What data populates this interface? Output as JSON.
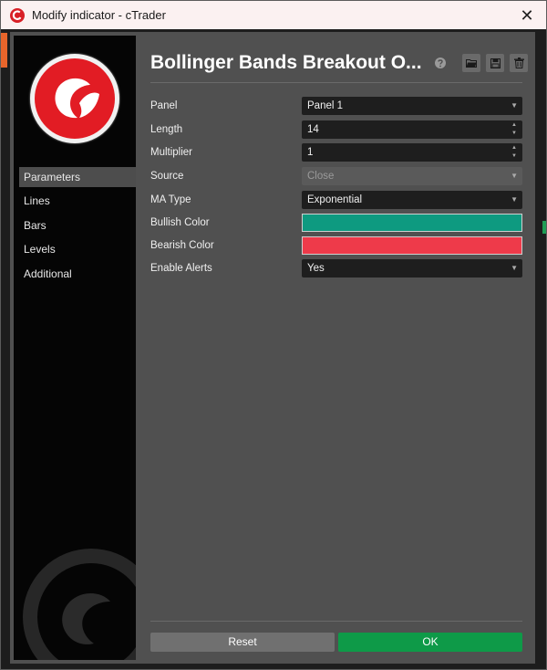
{
  "window": {
    "title": "Modify indicator - cTrader",
    "close_glyph": "✕",
    "app_icon": "ctrader-logo-icon"
  },
  "sidebar": {
    "logo": "ctrader-logo-icon",
    "items": [
      {
        "label": "Parameters",
        "active": true
      },
      {
        "label": "Lines",
        "active": false
      },
      {
        "label": "Bars",
        "active": false
      },
      {
        "label": "Levels",
        "active": false
      },
      {
        "label": "Additional",
        "active": false
      }
    ]
  },
  "header": {
    "title": "Bollinger Bands Breakout O...",
    "icons": [
      "help-icon",
      "open-folder-icon",
      "save-icon",
      "trash-icon"
    ]
  },
  "parameters": {
    "panel": {
      "label": "Panel",
      "value": "Panel 1"
    },
    "length": {
      "label": "Length",
      "value": "14"
    },
    "multiplier": {
      "label": "Multiplier",
      "value": "1"
    },
    "source": {
      "label": "Source",
      "value": "Close"
    },
    "ma_type": {
      "label": "MA Type",
      "value": "Exponential"
    },
    "bullish_color": {
      "label": "Bullish Color",
      "color": "#0e9a80"
    },
    "bearish_color": {
      "label": "Bearish Color",
      "color": "#ee3a4a"
    },
    "enable_alerts": {
      "label": "Enable Alerts",
      "value": "Yes"
    }
  },
  "footer": {
    "reset_label": "Reset",
    "ok_label": "OK"
  },
  "colors": {
    "brand_red": "#e21c24",
    "ok_green": "#0e9a48",
    "dialog_bg": "#505050"
  }
}
